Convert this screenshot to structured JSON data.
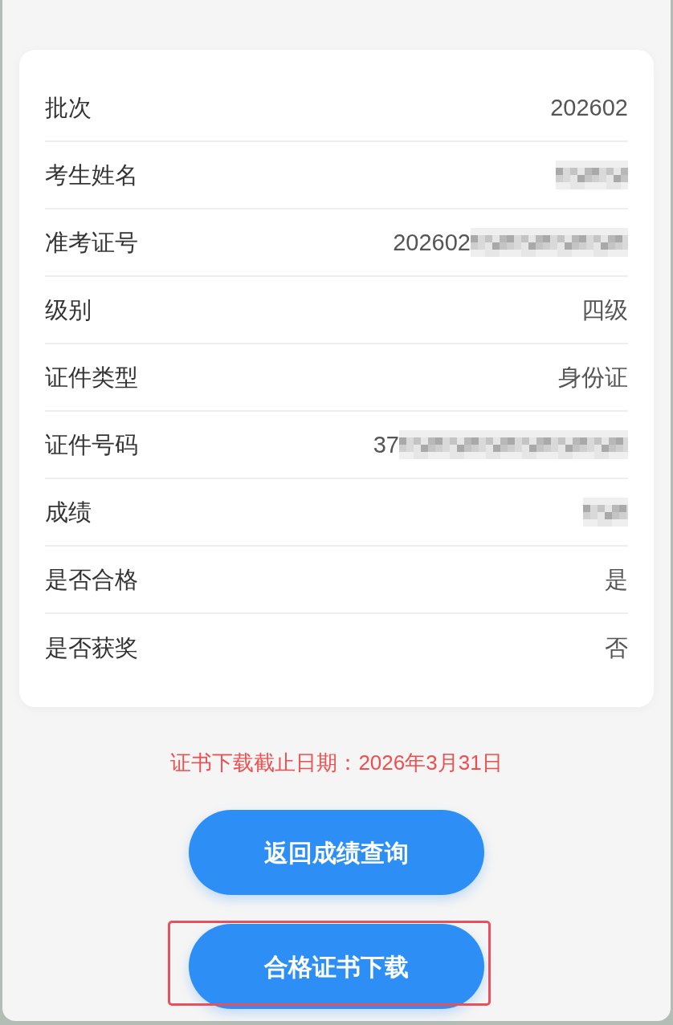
{
  "info_rows": [
    {
      "label": "批次",
      "value": "202602"
    },
    {
      "label": "考生姓名",
      "redacted": true
    },
    {
      "label": "准考证号",
      "value": "202602",
      "redacted": true
    },
    {
      "label": "级别",
      "value": "四级"
    },
    {
      "label": "证件类型",
      "value": "身份证"
    },
    {
      "label": "证件号码",
      "value": "37",
      "redacted": true
    },
    {
      "label": "成绩",
      "redacted": true
    },
    {
      "label": "是否合格",
      "value": "是"
    },
    {
      "label": "是否获奖",
      "value": "否"
    }
  ],
  "deadline_notice": "证书下载截止日期：2026年3月31日",
  "buttons": [
    {
      "label": "返回成绩查询",
      "highlighted": false
    },
    {
      "label": "合格证书下载",
      "highlighted": true
    }
  ]
}
